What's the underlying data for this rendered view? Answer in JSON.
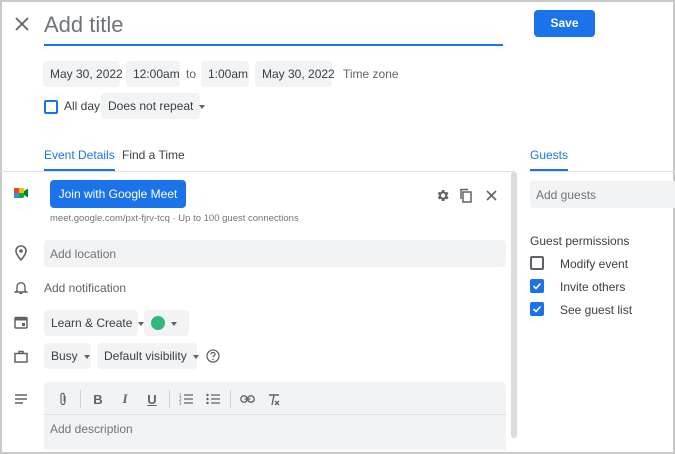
{
  "header": {
    "close_label": "✕",
    "title_placeholder": "Add title",
    "save_label": "Save"
  },
  "datetime": {
    "start_date": "May 30, 2022",
    "start_time": "12:00am",
    "to_label": "to",
    "end_time": "1:00am",
    "end_date": "May 30, 2022",
    "timezone_label": "Time zone",
    "all_day_label": "All day",
    "repeat_value": "Does not repeat"
  },
  "tabs": {
    "event_details": "Event Details",
    "find_time": "Find a Time",
    "guests": "Guests"
  },
  "meet": {
    "button_label": "Join with Google Meet",
    "link_text": "meet.google.com/pxt-fjrv-tcq",
    "limit_text": " · Up to 100 guest connections"
  },
  "location": {
    "placeholder": "Add location"
  },
  "notification": {
    "label": "Add notification"
  },
  "calendar": {
    "name": "Learn & Create",
    "color": "#33b679"
  },
  "availability": {
    "busy_value": "Busy",
    "visibility_value": "Default visibility"
  },
  "description": {
    "placeholder": "Add description"
  },
  "guests": {
    "input_placeholder": "Add guests",
    "permissions_title": "Guest permissions",
    "permissions": [
      {
        "label": "Modify event",
        "checked": false
      },
      {
        "label": "Invite others",
        "checked": true
      },
      {
        "label": "See guest list",
        "checked": true
      }
    ]
  },
  "colors": {
    "accent": "#1a73e8",
    "chip_bg": "#f1f3f4",
    "meet_green": "#00ac47"
  }
}
